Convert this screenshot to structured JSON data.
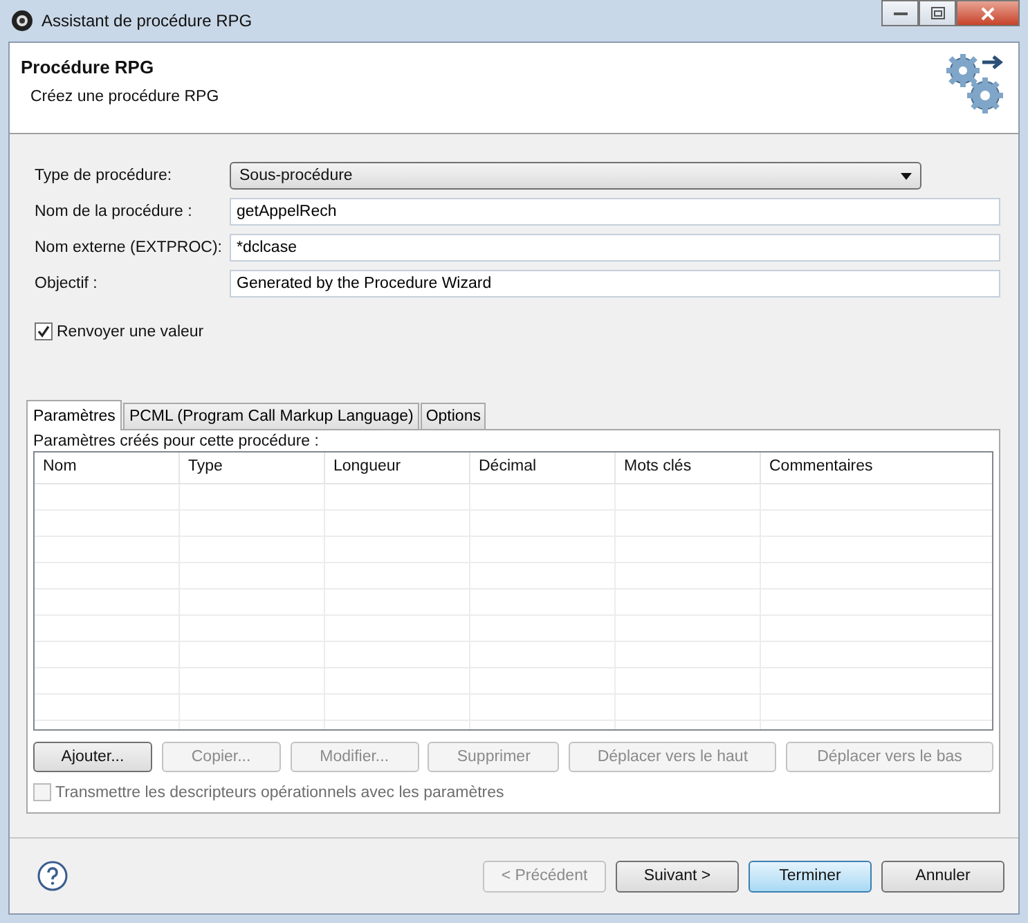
{
  "window": {
    "title": "Assistant de procédure RPG"
  },
  "header": {
    "title": "Procédure RPG",
    "subtitle": "Créez une procédure RPG"
  },
  "fields": [
    {
      "kind": "dropdown",
      "label": "Type de procédure:",
      "value": "Sous-procédure"
    },
    {
      "kind": "text",
      "label": "Nom de la procédure :",
      "value": "getAppelRech"
    },
    {
      "kind": "text",
      "label": "Nom externe (EXTPROC):",
      "value": "*dclcase"
    },
    {
      "kind": "text",
      "label": "Objectif :",
      "value": "Generated by the Procedure Wizard"
    }
  ],
  "return_value": {
    "label": "Renvoyer une valeur",
    "checked": true,
    "disabled": false
  },
  "tabs": [
    {
      "label": "Paramètres",
      "selected": true
    },
    {
      "label": "PCML (Program Call Markup Language)",
      "selected": false
    },
    {
      "label": "Options",
      "selected": false
    }
  ],
  "table": {
    "caption": "Paramètres créés pour cette procédure :",
    "columns": [
      "Nom",
      "Type",
      "Longueur",
      "Décimal",
      "Mots clés",
      "Commentaires"
    ]
  },
  "table_buttons": [
    {
      "label": "Ajouter...",
      "disabled": false
    },
    {
      "label": "Copier...",
      "disabled": true
    },
    {
      "label": "Modifier...",
      "disabled": true
    },
    {
      "label": "Supprimer",
      "disabled": true
    },
    {
      "label": "Déplacer vers le haut",
      "disabled": true
    },
    {
      "label": "Déplacer vers le bas",
      "disabled": true
    }
  ],
  "descriptors": {
    "label": "Transmettre les descripteurs opérationnels avec les paramètres",
    "checked": false,
    "disabled": true
  },
  "footer_buttons": [
    {
      "label": "< Précédent",
      "disabled": true,
      "default": false
    },
    {
      "label": "Suivant >",
      "disabled": false,
      "default": false
    },
    {
      "label": "Terminer",
      "disabled": false,
      "default": true
    },
    {
      "label": "Annuler",
      "disabled": false,
      "default": false
    }
  ]
}
